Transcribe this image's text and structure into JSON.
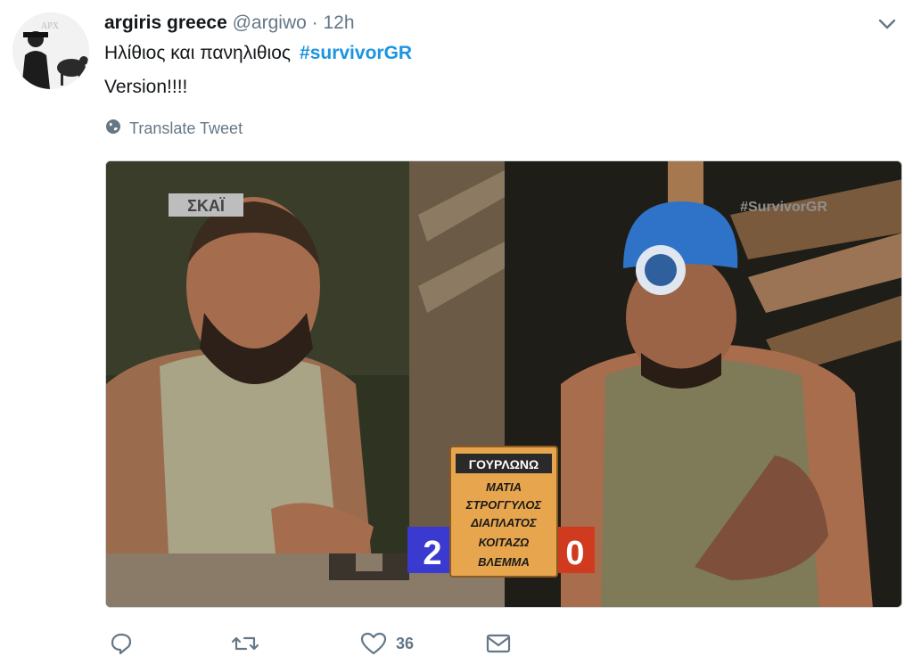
{
  "tweet": {
    "display_name": "argiris greece",
    "handle": "@argiwo",
    "separator": "·",
    "time": "12h",
    "text_line1": "Ηλίθιος και πανηλιθιος",
    "hashtag": "#survivorGR",
    "text_line2": "Version!!!!",
    "translate_label": "Translate Tweet"
  },
  "media": {
    "channel_logo": "ΣΚΑΪ",
    "watermark": "#SurvivorGR",
    "score_left": "2",
    "score_right": "0",
    "board_header": "ΓΟΥΡΛΩΝΩ",
    "board_lines": [
      "ΜΑΤΙΑ",
      "ΣΤΡΟΓΓΥΛΟΣ",
      "ΔΙΑΠΛΑΤΟΣ",
      "ΚΟΙΤΑΖΩ",
      "ΒΛΕΜΜΑ"
    ],
    "score_left_color": "#3a3ad0",
    "score_right_color": "#d03a1e"
  },
  "actions": {
    "reply_icon": "reply-icon",
    "retweet_icon": "retweet-icon",
    "like_icon": "heart-icon",
    "like_count": "36",
    "message_icon": "envelope-icon"
  },
  "colors": {
    "link": "#1b95e0",
    "secondary_text": "#657786"
  }
}
